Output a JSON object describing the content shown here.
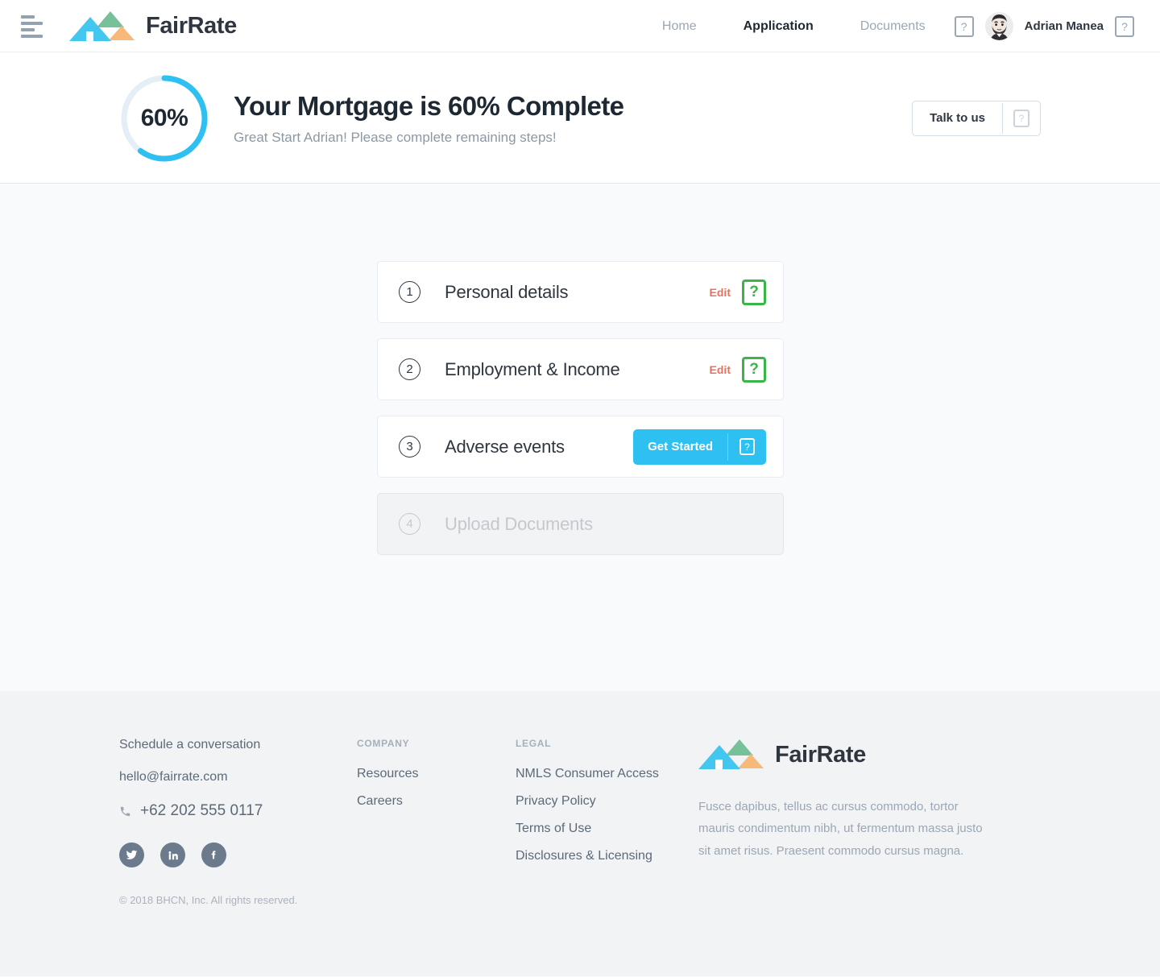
{
  "header": {
    "menu_icon": "hamburger-menu-icon",
    "brand": "FairRate",
    "nav": [
      {
        "label": "Home",
        "active": false
      },
      {
        "label": "Application",
        "active": true
      },
      {
        "label": "Documents",
        "active": false
      }
    ],
    "help_icon_label": "?",
    "user_name": "Adrian Manea",
    "user_help_icon_label": "?"
  },
  "hero": {
    "progress_percent": "60%",
    "progress_value": 60,
    "title": "Your Mortgage is 60% Complete",
    "subtitle": "Great Start Adrian! Please complete remaining steps!",
    "talk_button": "Talk to us",
    "talk_button_help": "?"
  },
  "steps": [
    {
      "number": "1",
      "title": "Personal details",
      "action_label": "Edit",
      "action_type": "edit",
      "badge": "?",
      "disabled": false
    },
    {
      "number": "2",
      "title": "Employment & Income",
      "action_label": "Edit",
      "action_type": "edit",
      "badge": "?",
      "disabled": false
    },
    {
      "number": "3",
      "title": "Adverse events",
      "action_label": "Get Started",
      "action_type": "cta",
      "badge": "?",
      "disabled": false
    },
    {
      "number": "4",
      "title": "Upload Documents",
      "action_label": "",
      "action_type": "none",
      "badge": "",
      "disabled": true
    }
  ],
  "footer": {
    "contact": {
      "schedule": "Schedule a conversation",
      "email": "hello@fairrate.com",
      "phone": "+62 202 555 0117",
      "socials": [
        "twitter-icon",
        "linkedin-icon",
        "facebook-icon"
      ]
    },
    "columns": [
      {
        "heading": "COMPANY",
        "links": [
          "Resources",
          "Careers"
        ]
      },
      {
        "heading": "LEGAL",
        "links": [
          "NMLS Consumer Access",
          "Privacy Policy",
          "Terms of Use",
          "Disclosures & Licensing"
        ]
      }
    ],
    "brand": "FairRate",
    "description": "Fusce dapibus, tellus ac cursus commodo, tortor mauris condimentum nibh, ut fermentum massa justo sit amet risus. Praesent commodo cursus magna.",
    "copyright": "© 2018 BHCN, Inc. All rights reserved."
  },
  "colors": {
    "accent_cyan": "#2ec0f0",
    "logo_cyan": "#43c7ef",
    "logo_green": "#76c09a",
    "logo_orange": "#f6b97a",
    "edit_red": "#e9705f",
    "badge_green": "#3ab54a",
    "text_dark": "#1e2833",
    "text_muted": "#8c98a5"
  }
}
